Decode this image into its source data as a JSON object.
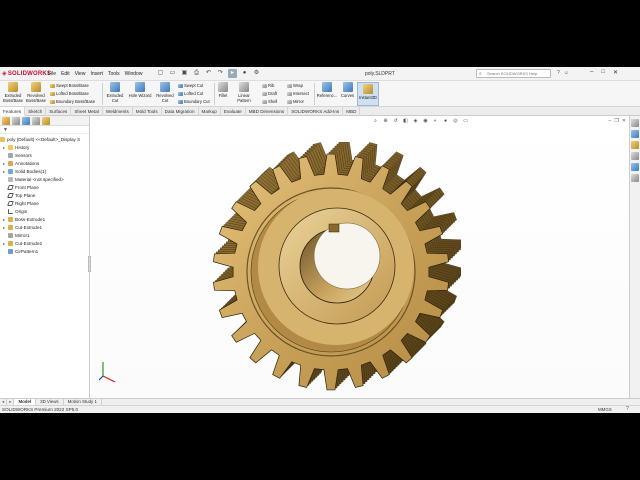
{
  "app": {
    "logo_text": "SOLIDWORKS",
    "document_title": "poly.SLDPRT",
    "menus": [
      "File",
      "Edit",
      "View",
      "Insert",
      "Tools",
      "Window"
    ],
    "search_placeholder": "Search SOLIDWORKS Help",
    "colors": {
      "brand": "#c8102e",
      "gear_face": "#c9a25a",
      "background": "#ffffff",
      "active_tab_bg": "#cfe0f4"
    }
  },
  "ribbon": {
    "extruded_boss": "Extruded Boss/Base",
    "revolved_boss": "Revolved Boss/Base",
    "swept_boss": "Swept Boss/Base",
    "lofted_boss": "Lofted Boss/Base",
    "boundary_boss": "Boundary Boss/Base",
    "extruded_cut": "Extruded Cut",
    "hole_wizard": "Hole Wizard",
    "revolved_cut": "Revolved Cut",
    "swept_cut": "Swept Cut",
    "lofted_cut": "Lofted Cut",
    "boundary_cut": "Boundary Cut",
    "fillet": "Fillet",
    "linear_pattern": "Linear Pattern",
    "rib": "Rib",
    "draft": "Draft",
    "shell": "Shell",
    "wrap": "Wrap",
    "intersect": "Intersect",
    "mirror": "Mirror",
    "reference": "Referenc...",
    "curves": "Curves",
    "instant3d": "Instant3D"
  },
  "tabs": [
    "Features",
    "Sketch",
    "Surfaces",
    "Sheet Metal",
    "Weldments",
    "Mold Tools",
    "Data Migration",
    "Markup",
    "Evaluate",
    "MBD Dimensions",
    "SOLIDWORKS Add-Ins",
    "MBD"
  ],
  "active_tab": "Features",
  "feature_tree": {
    "root": "poly (Default) <<Default>_Display S",
    "items": [
      {
        "label": "History",
        "icon": "history-folder-icon",
        "expandable": true
      },
      {
        "label": "Sensors",
        "icon": "sensor-icon",
        "expandable": false
      },
      {
        "label": "Annotations",
        "icon": "annotations-icon",
        "expandable": true
      },
      {
        "label": "Solid Bodies(1)",
        "icon": "solid-bodies-icon",
        "expandable": true
      },
      {
        "label": "Material <not specified>",
        "icon": "material-icon",
        "expandable": false
      },
      {
        "label": "Front Plane",
        "icon": "plane-icon",
        "expandable": false
      },
      {
        "label": "Top Plane",
        "icon": "plane-icon",
        "expandable": false
      },
      {
        "label": "Right Plane",
        "icon": "plane-icon",
        "expandable": false
      },
      {
        "label": "Origin",
        "icon": "origin-icon",
        "expandable": false
      },
      {
        "label": "Boss-Extrude1",
        "icon": "extrude-icon",
        "expandable": true
      },
      {
        "label": "Cut-Extrude1",
        "icon": "cut-extrude-icon",
        "expandable": true
      },
      {
        "label": "Mirror1",
        "icon": "mirror-icon",
        "expandable": false
      },
      {
        "label": "Cut-Extrude2",
        "icon": "cut-extrude-icon",
        "expandable": true
      },
      {
        "label": "CirPattern1",
        "icon": "circular-pattern-icon",
        "expandable": false
      }
    ]
  },
  "model": {
    "name": "spur gear",
    "teeth": 26
  },
  "bottom_tabs": [
    "Model",
    "3D Views",
    "Motion Study 1"
  ],
  "active_bottom_tab": "Model",
  "status": {
    "product": "SOLIDWORKS Premium 2022 SP5.0",
    "units": "MMGS",
    "help": "?"
  }
}
